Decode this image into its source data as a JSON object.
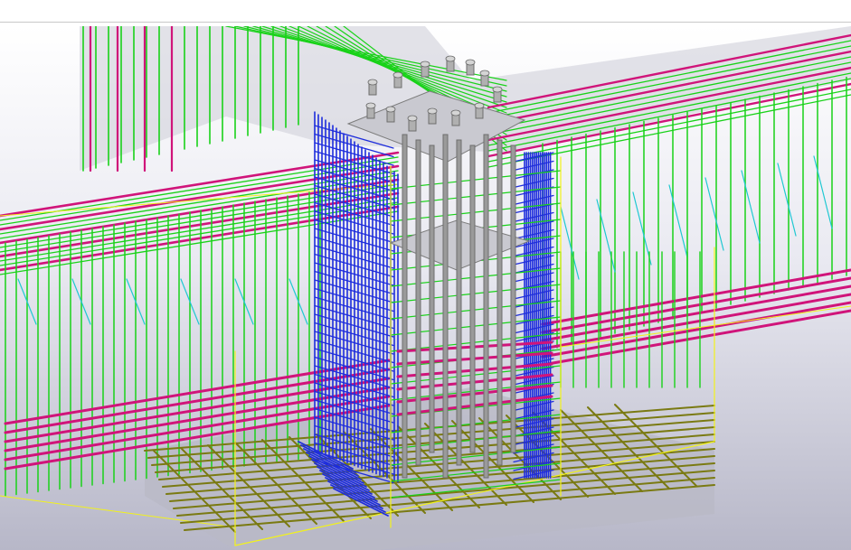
{
  "window": {
    "toolbar_label": ""
  },
  "viewport": {
    "background_top": "#ffffff",
    "background_bottom": "#b7b7c8"
  },
  "model": {
    "colors": {
      "stirrup_green": "#19d219",
      "longitudinal_magenta": "#d0147a",
      "column_blue": "#1e2ddc",
      "tie_cyan": "#1fc8d2",
      "outline_yellow": "#f2f21a",
      "footing_mesh_olive": "#7a7a12",
      "anchor_steel_gray": "#9a9a9a",
      "concrete_gray": "#c9c9d0"
    },
    "parts": [
      {
        "name": "rear-beam",
        "icon": "beam-icon"
      },
      {
        "name": "front-left-beam",
        "icon": "beam-icon"
      },
      {
        "name": "front-right-beam",
        "icon": "beam-icon"
      },
      {
        "name": "footing",
        "icon": "footing-icon"
      },
      {
        "name": "column",
        "icon": "column-icon"
      },
      {
        "name": "base-plate-with-anchor-bolts",
        "icon": "bolt-icon"
      }
    ]
  }
}
